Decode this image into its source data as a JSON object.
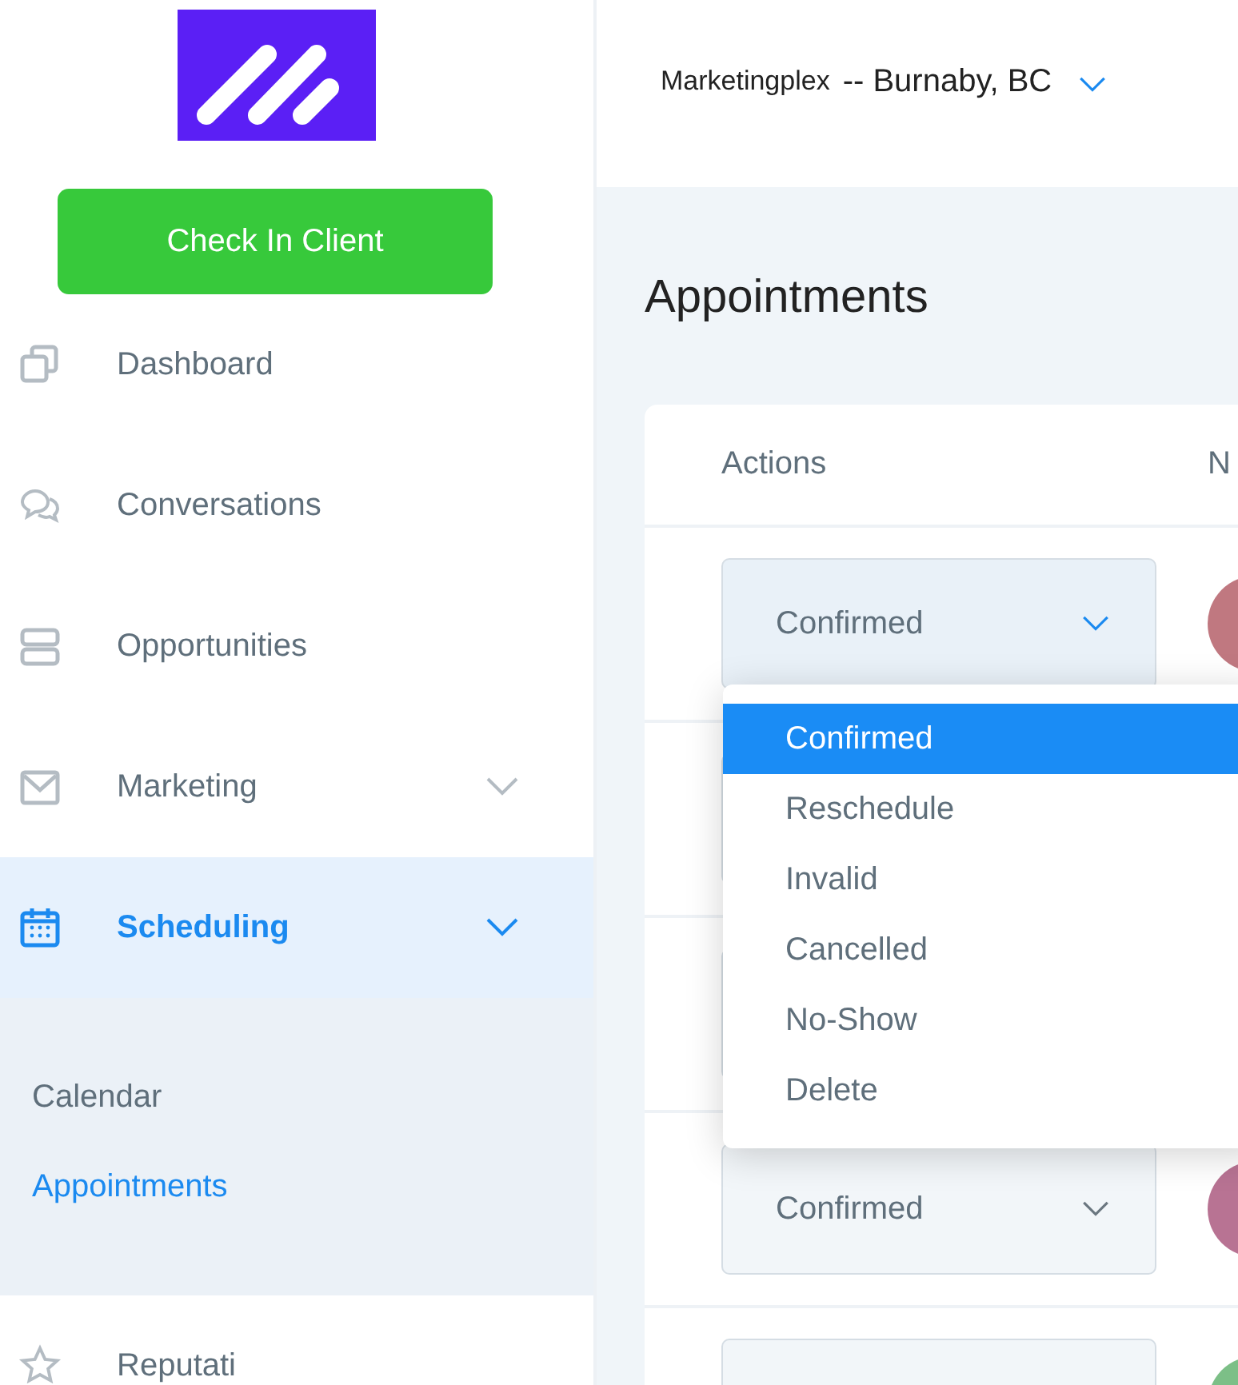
{
  "sidebar": {
    "check_in_button": "Check In Client",
    "items": [
      {
        "label": "Dashboard",
        "selected": false
      },
      {
        "label": "Conversations",
        "selected": false
      },
      {
        "label": "Opportunities",
        "selected": false
      },
      {
        "label": "Marketing",
        "selected": false,
        "expanded": false
      },
      {
        "label": "Scheduling",
        "selected": true,
        "expanded": true,
        "children": [
          {
            "label": "Calendar",
            "selected": false
          },
          {
            "label": "Appointments",
            "selected": true
          }
        ]
      },
      {
        "label": "Reputati",
        "selected": false
      }
    ]
  },
  "header": {
    "location": "Marketingplex",
    "location_detail": "-- Burnaby, BC"
  },
  "page_title": "Appointments",
  "table": {
    "columns": [
      "Actions",
      "N"
    ],
    "rows": [
      {
        "status": "Confirmed",
        "open": true,
        "color": "#c07880",
        "options": [
          {
            "label": "Confirmed",
            "selected": true
          },
          {
            "label": "Reschedule",
            "selected": false
          },
          {
            "label": "Invalid",
            "selected": false
          },
          {
            "label": "Cancelled",
            "selected": false
          },
          {
            "label": "No-Show",
            "selected": false
          },
          {
            "label": "Delete",
            "selected": false
          }
        ]
      },
      {},
      {},
      {
        "status": "Confirmed",
        "open": false,
        "color": "#b87393"
      },
      {
        "color": "#7cbf87"
      }
    ]
  }
}
